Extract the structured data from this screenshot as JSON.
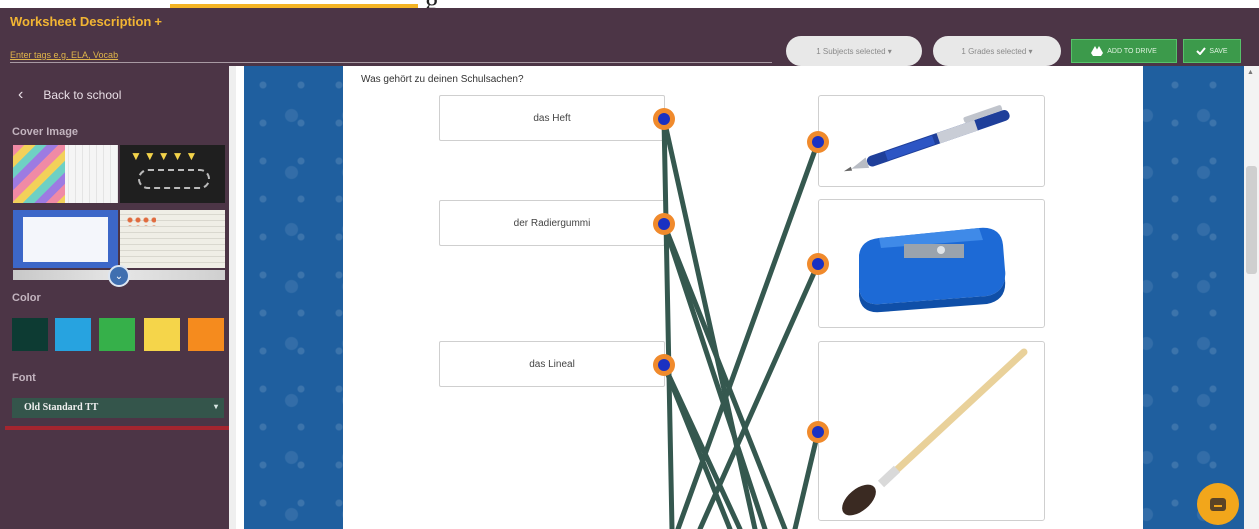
{
  "top": {
    "fragment_glyph": "g"
  },
  "header": {
    "title": "Worksheet Description",
    "title_plus": "+",
    "tags_placeholder": "Enter tags e.g. ELA, Vocab",
    "subjects_pill": "1 Subjects selected ▾",
    "grades_pill": "1 Grades selected ▾",
    "add_to_drive_label": "ADD TO DRIVE",
    "save_label": "SAVE",
    "colors": {
      "bar": "#4c3546",
      "accent": "#f2b533",
      "action": "#3c9a4b"
    }
  },
  "sidebar": {
    "back_icon": "‹",
    "back_label": "Back to school",
    "cover_label": "Cover Image",
    "expand_icon": "⌄",
    "color_label": "Color",
    "swatches": [
      "#0d3b33",
      "#27a3e0",
      "#36b04a",
      "#f5d54a",
      "#f58b1e"
    ],
    "font_label": "Font",
    "font_value": "Old Standard TT",
    "font_arrow": "▾"
  },
  "worksheet": {
    "question": "Was gehört zu deinen Schulsachen?",
    "words": [
      "das Heft",
      "der Radiergummi",
      "das Lineal"
    ],
    "images": [
      "pen",
      "pencil-sharpener",
      "paintbrush"
    ]
  },
  "scrollbar": {
    "up_arrow": "▲"
  }
}
